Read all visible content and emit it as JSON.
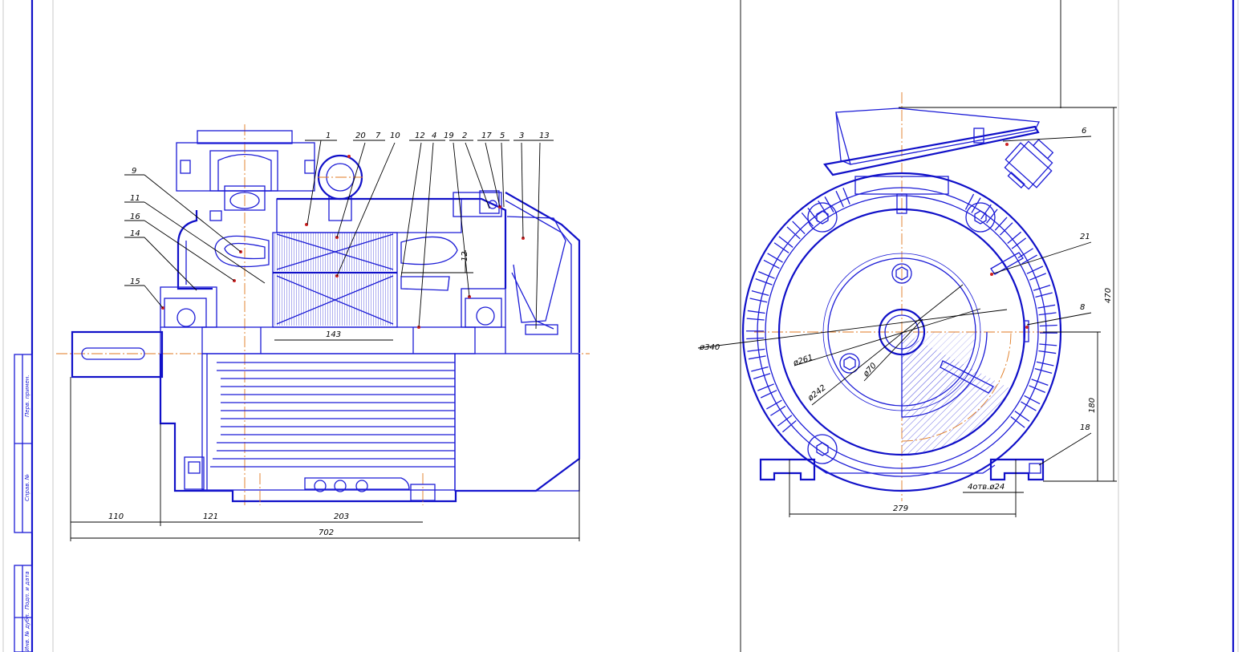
{
  "side_view": {
    "callouts": [
      "1",
      "20",
      "7",
      "10",
      "12",
      "4",
      "19",
      "2",
      "17",
      "5",
      "3",
      "13",
      "9",
      "11",
      "16",
      "14",
      "15"
    ],
    "dimensions": {
      "overall": "702",
      "shaft": "110",
      "d121": "121",
      "d203": "203",
      "core": "143",
      "gap": "12"
    }
  },
  "end_view": {
    "callouts": [
      "6",
      "21",
      "8",
      "18"
    ],
    "dimensions": {
      "d340": "ø340",
      "d261": "ø261",
      "d242": "ø242",
      "d70": "ø70",
      "height": "470",
      "axis_height": "180",
      "width": "279",
      "holes": "4отв.ø24"
    }
  },
  "frame_stamps": [
    "Перв. примен.",
    "Справ. №",
    "Подп. и дата",
    "Инв. № дубл."
  ],
  "colors": {
    "line": "#1b1bd6",
    "axis": "#e07a20",
    "marker": "#d02020"
  }
}
